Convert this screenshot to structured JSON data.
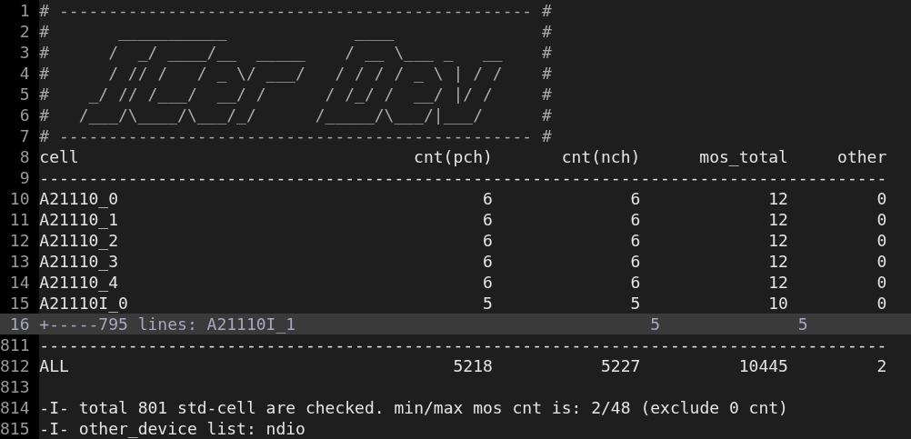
{
  "editor": {
    "lines": [
      {
        "number": "1",
        "kind": "comment",
        "text": "# ------------------------------------------------ #"
      },
      {
        "number": "2",
        "kind": "comment",
        "text": "#       ___________             ____               #"
      },
      {
        "number": "3",
        "kind": "comment",
        "text": "#      /  _/ ____/__  _____    / __ \\___ _   __    #"
      },
      {
        "number": "4",
        "kind": "comment",
        "text": "#      / // /   / _ \\/ ___/   / / / / _ \\ | / /    #"
      },
      {
        "number": "5",
        "kind": "comment",
        "text": "#    _/ // /___/  __/ /      / /_/ /  __/ |/ /     #"
      },
      {
        "number": "6",
        "kind": "comment",
        "text": "#   /___/\\____/\\___/_/      /_____/\\___/|___/      #"
      },
      {
        "number": "7",
        "kind": "comment",
        "text": "# ------------------------------------------------ #"
      },
      {
        "number": "8",
        "kind": "header",
        "cells": [
          "cell",
          "cnt(pch)",
          "cnt(nch)",
          "mos_total",
          "other"
        ]
      },
      {
        "number": "9",
        "kind": "rule",
        "text": "--------------------------------------------------------------------------------------"
      },
      {
        "number": "10",
        "kind": "row",
        "cells": [
          "A21110_0",
          "6",
          "6",
          "12",
          "0"
        ]
      },
      {
        "number": "11",
        "kind": "row",
        "cells": [
          "A21110_1",
          "6",
          "6",
          "12",
          "0"
        ]
      },
      {
        "number": "12",
        "kind": "row",
        "cells": [
          "A21110_2",
          "6",
          "6",
          "12",
          "0"
        ]
      },
      {
        "number": "13",
        "kind": "row",
        "cells": [
          "A21110_3",
          "6",
          "6",
          "12",
          "0"
        ]
      },
      {
        "number": "14",
        "kind": "row",
        "cells": [
          "A21110_4",
          "6",
          "6",
          "12",
          "0"
        ]
      },
      {
        "number": "15",
        "kind": "row",
        "cells": [
          "A21110I_0",
          "5",
          "5",
          "10",
          "0"
        ]
      },
      {
        "number": "16",
        "kind": "fold",
        "text": "+-----795 lines: A21110I_1",
        "values": [
          "5",
          "5"
        ]
      },
      {
        "number": "811",
        "kind": "rule",
        "text": "--------------------------------------------------------------------------------------"
      },
      {
        "number": "812",
        "kind": "row",
        "cells": [
          "ALL",
          "5218",
          "5227",
          "10445",
          "2"
        ]
      },
      {
        "number": "813",
        "kind": "blank"
      },
      {
        "number": "814",
        "kind": "text",
        "text": "-I- total 801 std-cell are checked. min/max mos cnt is: 2/48 (exclude 0 cnt)"
      },
      {
        "number": "815",
        "kind": "text",
        "text": "-I- other_device list: ndio"
      }
    ]
  }
}
